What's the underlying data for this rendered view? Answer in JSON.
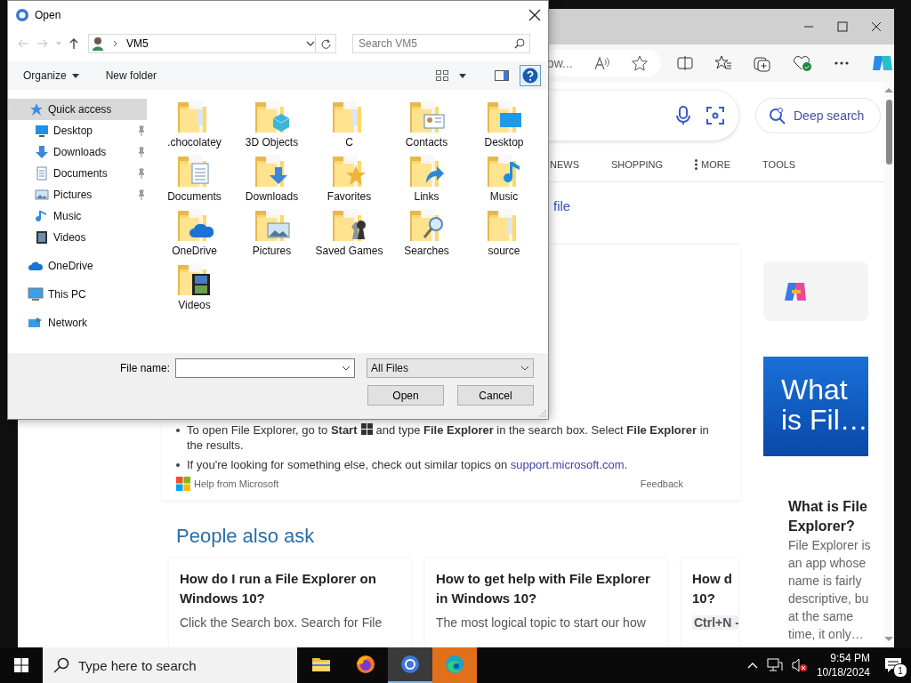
{
  "browser": {
    "address_fragment": "ow...",
    "deep_search": "Deep search",
    "tabs": [
      {
        "label": "NEWS",
        "kind": "tab"
      },
      {
        "label": "SHOPPING",
        "kind": "tab"
      },
      {
        "label": "MORE",
        "kind": "menu"
      },
      {
        "label": "TOOLS",
        "kind": "tab"
      }
    ],
    "answer": {
      "heading_fragment": "file",
      "bullets": [
        {
          "kind": "start",
          "before": "To open File Explorer, go to **Start**",
          "after": "and type **File Explorer** in the search box. Select **File Explorer** in the results."
        },
        {
          "kind": "link",
          "before": "If you're looking for something else, check out similar topics on",
          "link": "support.microsoft.com",
          "after": "."
        }
      ],
      "source": "Help from Microsoft",
      "feedback": "Feedback"
    },
    "people_also_ask": {
      "title": "People also ask",
      "questions": [
        {
          "question_lines": [
            "How do I run a File Explorer on",
            "Windows 10?"
          ],
          "snippet": "Click the Search box. Search for File",
          "kind": "text"
        },
        {
          "question_lines": [
            "How to get help with File Explorer",
            "in Windows 10?"
          ],
          "snippet": "The most logical topic to start our how",
          "kind": "text"
        },
        {
          "question_lines": [
            "How d",
            "10?"
          ],
          "snippet": "Ctrl+N -",
          "kind": "shortcut"
        }
      ]
    },
    "side": {
      "image_title": "What is Fil…",
      "title": "What is File Explorer?",
      "body_lines": [
        "File Explorer is",
        "an app whose",
        "name is fairly",
        "descriptive, bu",
        "at the same",
        "time, it only…"
      ]
    }
  },
  "dialog": {
    "title": "Open",
    "path": "VM5",
    "search_placeholder": "Search VM5",
    "organize": "Organize",
    "new_folder": "New folder",
    "nav_pane": [
      {
        "label": "Quick access",
        "kind": "quick",
        "selected": true,
        "children": [
          {
            "label": "Desktop",
            "kind": "desktop",
            "pinned": true,
            "selected": false
          },
          {
            "label": "Downloads",
            "kind": "downloads",
            "pinned": true,
            "selected": false
          },
          {
            "label": "Documents",
            "kind": "documents",
            "pinned": true,
            "selected": false
          },
          {
            "label": "Pictures",
            "kind": "pictures",
            "pinned": true,
            "selected": false
          },
          {
            "label": "Music",
            "kind": "music",
            "pinned": false,
            "selected": false
          },
          {
            "label": "Videos",
            "kind": "videos",
            "pinned": false,
            "selected": false
          }
        ]
      },
      {
        "label": "OneDrive",
        "kind": "onedrive",
        "selected": false
      },
      {
        "label": "This PC",
        "kind": "pc",
        "selected": false
      },
      {
        "label": "Network",
        "kind": "network",
        "selected": false
      }
    ],
    "files": [
      {
        "name": ".chocolatey",
        "kind": "plain"
      },
      {
        "name": "3D Objects",
        "kind": "objects3d"
      },
      {
        "name": "C",
        "kind": "plain"
      },
      {
        "name": "Contacts",
        "kind": "contacts"
      },
      {
        "name": "Desktop",
        "kind": "desktop"
      },
      {
        "name": "Documents",
        "kind": "documents"
      },
      {
        "name": "Downloads",
        "kind": "downloads"
      },
      {
        "name": "Favorites",
        "kind": "favorites"
      },
      {
        "name": "Links",
        "kind": "links"
      },
      {
        "name": "Music",
        "kind": "music"
      },
      {
        "name": "OneDrive",
        "kind": "onedrive"
      },
      {
        "name": "Pictures",
        "kind": "pictures"
      },
      {
        "name": "Saved Games",
        "kind": "games"
      },
      {
        "name": "Searches",
        "kind": "searches"
      },
      {
        "name": "source",
        "kind": "plain"
      },
      {
        "name": "Videos",
        "kind": "videos"
      }
    ],
    "file_name_label": "File name:",
    "file_type": "All Files",
    "buttons": [
      "Open",
      "Cancel"
    ]
  },
  "taskbar": {
    "search_placeholder": "Type here to search",
    "apps": [
      {
        "kind": "explorer",
        "active": false,
        "attention": false
      },
      {
        "kind": "firefox",
        "active": false,
        "attention": false
      },
      {
        "kind": "chrome",
        "active": true,
        "attention": false
      },
      {
        "kind": "edge",
        "active": false,
        "attention": true
      }
    ],
    "time": "9:54 PM",
    "date": "10/18/2024",
    "notification_count": "1"
  }
}
